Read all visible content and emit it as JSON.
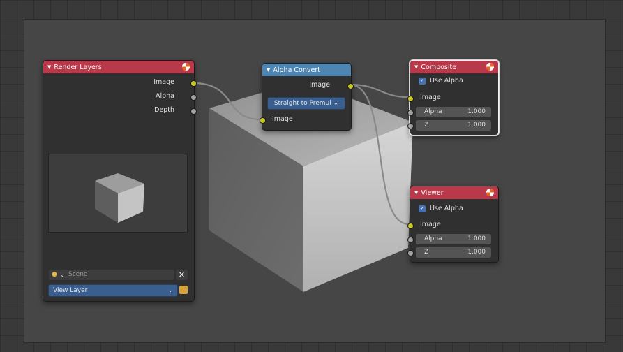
{
  "nodes": {
    "render_layers": {
      "title": "Render Layers",
      "outputs": [
        "Image",
        "Alpha",
        "Depth"
      ],
      "scene_label": "Scene",
      "view_layer_label": "View Layer"
    },
    "alpha_convert": {
      "title": "Alpha Convert",
      "output_label": "Image",
      "mode_value": "Straight to Premul",
      "input_label": "Image"
    },
    "composite": {
      "title": "Composite",
      "use_alpha_label": "Use Alpha",
      "image_label": "Image",
      "alpha_label": "Alpha",
      "alpha_value": "1.000",
      "z_label": "Z",
      "z_value": "1.000"
    },
    "viewer": {
      "title": "Viewer",
      "use_alpha_label": "Use Alpha",
      "image_label": "Image",
      "alpha_label": "Alpha",
      "alpha_value": "1.000",
      "z_label": "Z",
      "z_value": "1.000"
    }
  },
  "colors": {
    "render_layers_header": "#b9394a",
    "alpha_convert_header": "#4d86b3",
    "composite_header": "#b9394a",
    "viewer_header": "#b9394a",
    "image_socket": "#c7c729",
    "value_socket": "#a1a1a1"
  },
  "icons": {
    "collapse": "triangle-down",
    "scene": "scene-icon",
    "remove": "x-icon",
    "view_layer": "render-layers-icon",
    "node_type": "render-badge-icon"
  }
}
